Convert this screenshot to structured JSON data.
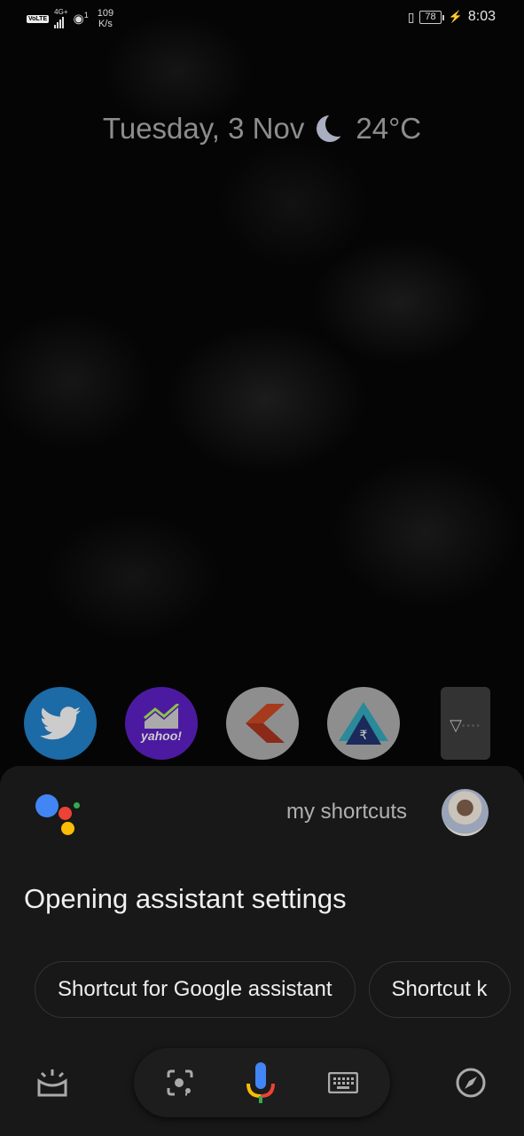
{
  "status_bar": {
    "volte": "VoLTE",
    "network_type": "4G+",
    "hotspot_count": "1",
    "speed_value": "109",
    "speed_unit": "K/s",
    "battery_level": "78",
    "time": "8:03"
  },
  "lockscreen": {
    "date": "Tuesday, 3 Nov",
    "weather_icon": "moon-icon",
    "temperature": "24°C"
  },
  "dock_apps": [
    {
      "name": "Twitter",
      "icon": "twitter-icon",
      "color": "#1c6aa6"
    },
    {
      "name": "Yahoo Finance",
      "icon": "yahoo-finance-icon",
      "label": "yahoo!",
      "color": "#4c1aa0"
    },
    {
      "name": "Kite",
      "icon": "kite-icon",
      "color": "#8e8e8e"
    },
    {
      "name": "Banking",
      "icon": "rupee-icon",
      "rupee": "₹",
      "color": "#8e8e8e"
    },
    {
      "name": "Downloader",
      "icon": "download-icon",
      "color": "#a53a1d"
    }
  ],
  "assistant": {
    "query": "my shortcuts",
    "response": "Opening assistant settings",
    "suggestions": [
      "Shortcut for Google assistant",
      "Shortcut k"
    ],
    "colors": {
      "blue": "#4285f4",
      "red": "#ea4335",
      "yellow": "#fbbc05",
      "green": "#34a853"
    },
    "bottom_icons": [
      "updates-icon",
      "lens-icon",
      "mic-icon",
      "keyboard-icon",
      "explore-icon"
    ]
  }
}
